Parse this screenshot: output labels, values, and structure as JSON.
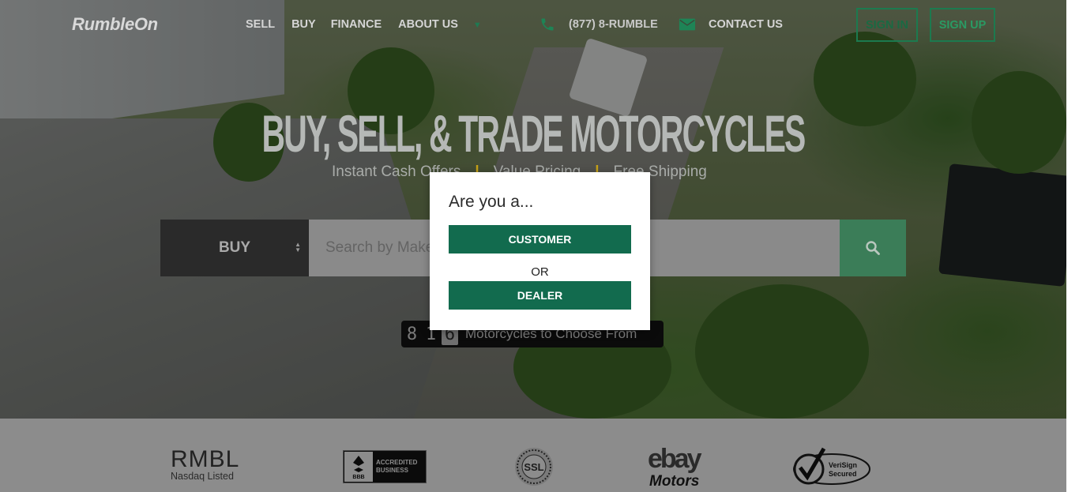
{
  "header": {
    "logo": "RumbleOn",
    "nav": [
      "SELL",
      "BUY",
      "FINANCE",
      "ABOUT US"
    ],
    "phone": "(877) 8-RUMBLE",
    "contact": "CONTACT US",
    "sign_in": "SIGN IN",
    "sign_up": "SIGN UP"
  },
  "hero": {
    "headline": "BUY, SELL, & TRADE MOTORCYCLES",
    "tagline": [
      "Instant Cash Offers",
      "Value Pricing",
      "Free Shipping"
    ],
    "separator": "|"
  },
  "search": {
    "mode": "BUY",
    "placeholder": "Search by Make, Model"
  },
  "counter": {
    "digits": [
      "8",
      "1",
      "6"
    ],
    "label": "Motorcycles to Choose From"
  },
  "trust_logos": {
    "rmbl": "RMBL",
    "rmbl_sub": "Nasdaq Listed",
    "bbb_line1": "ACCREDITED",
    "bbb_line2": "BUSINESS",
    "bbb_seal": "BBB",
    "ssl": "SSL",
    "ebay": "ebay",
    "ebay_sub": "Motors",
    "verisign_line1": "VeriSign",
    "verisign_line2": "Secured"
  },
  "modal": {
    "title": "Are you a...",
    "customer": "CUSTOMER",
    "or": "OR",
    "dealer": "DEALER"
  },
  "colors": {
    "brand_green": "#126b4e",
    "accent_gold": "#c8a317"
  }
}
